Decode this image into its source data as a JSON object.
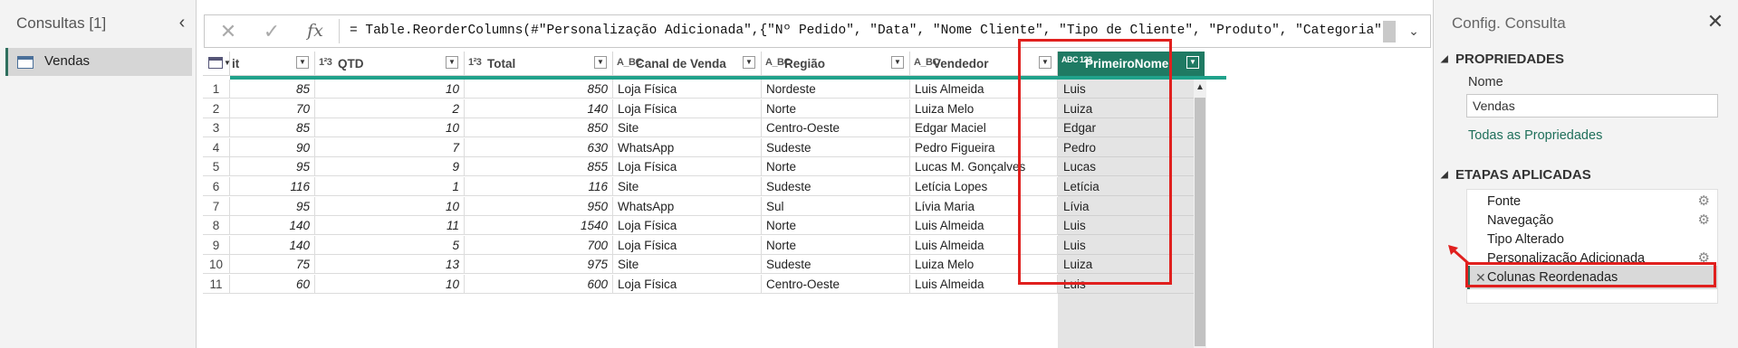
{
  "queries": {
    "title": "Consultas [1]",
    "collapse_icon": "chevron-left",
    "items": [
      {
        "label": "Vendas",
        "icon": "table-icon"
      }
    ]
  },
  "formula_bar": {
    "cancel_icon": "✕",
    "ok_icon": "✓",
    "fx_label": "fx",
    "text": "= Table.ReorderColumns(#\"Personalização Adicionada\",{\"Nº Pedido\", \"Data\", \"Nome Cliente\", \"Tipo de Cliente\", \"Produto\", \"Categoria\",",
    "expand_icon": "chevron-down"
  },
  "grid": {
    "columns": [
      {
        "name": "it",
        "type": ""
      },
      {
        "name": "QTD",
        "type": "1²3"
      },
      {
        "name": "Total",
        "type": "1²3"
      },
      {
        "name": "Canal de Venda",
        "type": "A_BC"
      },
      {
        "name": "Região",
        "type": "A_BC"
      },
      {
        "name": "Vendedor",
        "type": "A_BC"
      },
      {
        "name": "PrimeiroNome",
        "type": "ABC 123"
      }
    ],
    "rows": [
      {
        "n": "1",
        "it": "85",
        "qtd": "10",
        "total": "850",
        "canal": "Loja Física",
        "regiao": "Nordeste",
        "vendedor": "Luis Almeida",
        "primeiro": "Luis"
      },
      {
        "n": "2",
        "it": "70",
        "qtd": "2",
        "total": "140",
        "canal": "Loja Física",
        "regiao": "Norte",
        "vendedor": "Luiza Melo",
        "primeiro": "Luiza"
      },
      {
        "n": "3",
        "it": "85",
        "qtd": "10",
        "total": "850",
        "canal": "Site",
        "regiao": "Centro-Oeste",
        "vendedor": "Edgar Maciel",
        "primeiro": "Edgar"
      },
      {
        "n": "4",
        "it": "90",
        "qtd": "7",
        "total": "630",
        "canal": "WhatsApp",
        "regiao": "Sudeste",
        "vendedor": "Pedro Figueira",
        "primeiro": "Pedro"
      },
      {
        "n": "5",
        "it": "95",
        "qtd": "9",
        "total": "855",
        "canal": "Loja Física",
        "regiao": "Norte",
        "vendedor": "Lucas M. Gonçalves",
        "primeiro": "Lucas"
      },
      {
        "n": "6",
        "it": "116",
        "qtd": "1",
        "total": "116",
        "canal": "Site",
        "regiao": "Sudeste",
        "vendedor": "Letícia Lopes",
        "primeiro": "Letícia"
      },
      {
        "n": "7",
        "it": "95",
        "qtd": "10",
        "total": "950",
        "canal": "WhatsApp",
        "regiao": "Sul",
        "vendedor": "Lívia Maria",
        "primeiro": "Lívia"
      },
      {
        "n": "8",
        "it": "140",
        "qtd": "11",
        "total": "1540",
        "canal": "Loja Física",
        "regiao": "Norte",
        "vendedor": "Luis Almeida",
        "primeiro": "Luis"
      },
      {
        "n": "9",
        "it": "140",
        "qtd": "5",
        "total": "700",
        "canal": "Loja Física",
        "regiao": "Norte",
        "vendedor": "Luis Almeida",
        "primeiro": "Luis"
      },
      {
        "n": "10",
        "it": "75",
        "qtd": "13",
        "total": "975",
        "canal": "Site",
        "regiao": "Sudeste",
        "vendedor": "Luiza Melo",
        "primeiro": "Luiza"
      },
      {
        "n": "11",
        "it": "60",
        "qtd": "10",
        "total": "600",
        "canal": "Loja Física",
        "regiao": "Centro-Oeste",
        "vendedor": "Luis Almeida",
        "primeiro": "Luis"
      }
    ]
  },
  "settings": {
    "title": "Config. Consulta",
    "properties_header": "PROPRIEDADES",
    "name_label": "Nome",
    "name_value": "Vendas",
    "all_properties_link": "Todas as Propriedades",
    "steps_header": "ETAPAS APLICADAS",
    "steps": [
      {
        "label": "Fonte",
        "gear": true
      },
      {
        "label": "Navegação",
        "gear": true
      },
      {
        "label": "Tipo Alterado",
        "gear": false
      },
      {
        "label": "Personalização Adicionada",
        "gear": true
      },
      {
        "label": "Colunas Reordenadas",
        "gear": false,
        "active": true
      }
    ]
  },
  "colors": {
    "accent": "#1f7a63",
    "highlight_red": "#e0201e",
    "quality_bar": "#20a28b"
  }
}
